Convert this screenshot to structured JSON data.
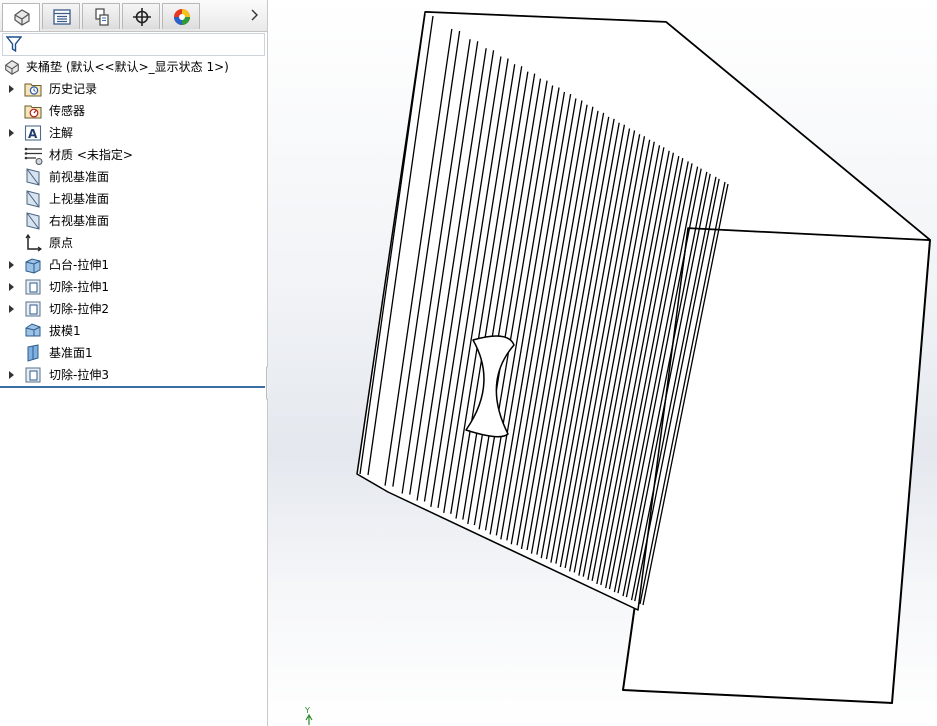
{
  "window": {
    "panel_tabs": [
      {
        "name": "feature-manager",
        "icon": "part-icon"
      },
      {
        "name": "property-manager",
        "icon": "property-manager-icon"
      },
      {
        "name": "configuration-manager",
        "icon": "configuration-icon"
      },
      {
        "name": "dimxpert-manager",
        "icon": "crosshair-icon"
      },
      {
        "name": "display-manager",
        "icon": "appearance-icon"
      }
    ],
    "more_tabs_icon": "chevron-right-icon",
    "filter_icon": "filter-icon"
  },
  "tree": {
    "root_label": "夹桶垫 (默认<<默认>_显示状态 1>)",
    "items": [
      {
        "label": "历史记录",
        "icon": "history-folder-icon",
        "expandable": true
      },
      {
        "label": "传感器",
        "icon": "sensors-folder-icon",
        "expandable": false
      },
      {
        "label": "注解",
        "icon": "annotations-icon",
        "expandable": true
      },
      {
        "label": "材质 <未指定>",
        "icon": "material-icon",
        "expandable": false
      },
      {
        "label": "前视基准面",
        "icon": "plane-icon",
        "expandable": false
      },
      {
        "label": "上视基准面",
        "icon": "plane-icon",
        "expandable": false
      },
      {
        "label": "右视基准面",
        "icon": "plane-icon",
        "expandable": false
      },
      {
        "label": "原点",
        "icon": "origin-icon",
        "expandable": false
      },
      {
        "label": "凸台-拉伸1",
        "icon": "boss-extrude-icon",
        "expandable": true
      },
      {
        "label": "切除-拉伸1",
        "icon": "cut-extrude-icon",
        "expandable": true
      },
      {
        "label": "切除-拉伸2",
        "icon": "cut-extrude-icon",
        "expandable": true
      },
      {
        "label": "拔模1",
        "icon": "draft-icon",
        "expandable": false
      },
      {
        "label": "基准面1",
        "icon": "ref-plane-icon",
        "expandable": false
      },
      {
        "label": "切除-拉伸3",
        "icon": "cut-extrude-icon",
        "expandable": true
      }
    ]
  },
  "viewport": {
    "triad_label": "Y",
    "colors": {
      "model_edge": "#000000",
      "model_face": "#ffffff",
      "accent": "#3a6ea5"
    }
  }
}
